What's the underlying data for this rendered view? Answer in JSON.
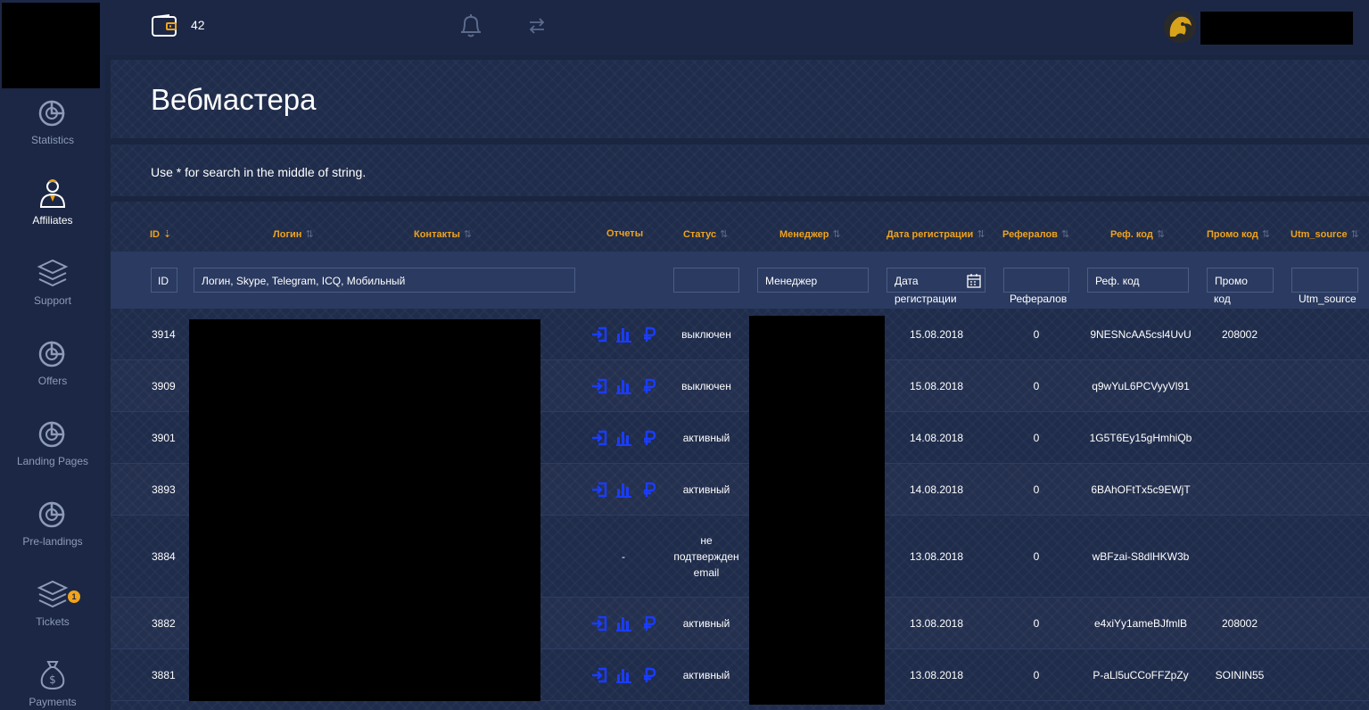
{
  "topbar": {
    "balance": "42"
  },
  "sidebar": {
    "items": [
      {
        "label": "Statistics",
        "icon": "pie-chart-icon"
      },
      {
        "label": "Affiliates",
        "icon": "user-icon",
        "active": true
      },
      {
        "label": "Support",
        "icon": "layers-icon"
      },
      {
        "label": "Offers",
        "icon": "pie-chart-icon"
      },
      {
        "label": "Landing Pages",
        "icon": "pie-chart-icon"
      },
      {
        "label": "Pre-landings",
        "icon": "pie-chart-icon"
      },
      {
        "label": "Tickets",
        "icon": "layers-icon",
        "badge": "1"
      },
      {
        "label": "Payments",
        "icon": "money-bag-icon"
      }
    ]
  },
  "page": {
    "title": "Вебмастера",
    "hint": "Use * for search in the middle of string."
  },
  "table": {
    "headers": {
      "id": "ID",
      "login": "Логин",
      "contacts": "Контакты",
      "reports": "Отчеты",
      "status": "Статус",
      "manager": "Менеджер",
      "reg_date": "Дата регистрации",
      "referrals": "Рефералов",
      "ref_code": "Реф. код",
      "promo_code": "Промо код",
      "utm_source": "Utm_source"
    },
    "filters": {
      "id": "ID",
      "login_contacts": "Логин, Skype, Telegram, ICQ, Мобильный",
      "status": "",
      "manager": "Менеджер",
      "reg_date_line1": "Дата",
      "reg_date_line2": "регистрации",
      "referrals": "Рефералов",
      "ref_code": "Реф. код",
      "promo_line1": "Промо",
      "promo_line2": "код",
      "utm_source": "Utm_source"
    },
    "rows": [
      {
        "id": "3914",
        "reports": true,
        "status": "выключен",
        "reg_date": "15.08.2018",
        "referrals": "0",
        "ref_code": "9NESNcAA5csl4UvU",
        "promo_code": "208002"
      },
      {
        "id": "3909",
        "reports": true,
        "status": "выключен",
        "reg_date": "15.08.2018",
        "referrals": "0",
        "ref_code": "q9wYuL6PCVyyVl91",
        "promo_code": ""
      },
      {
        "id": "3901",
        "reports": true,
        "status": "активный",
        "reg_date": "14.08.2018",
        "referrals": "0",
        "ref_code": "1G5T6Ey15gHmhiQb",
        "promo_code": ""
      },
      {
        "id": "3893",
        "reports": true,
        "status": "активный",
        "reg_date": "14.08.2018",
        "referrals": "0",
        "ref_code": "6BAhOFtTx5c9EWjT",
        "promo_code": ""
      },
      {
        "id": "3884",
        "reports": false,
        "reports_text": "-",
        "status_lines": [
          "не",
          "подтвержден",
          "email"
        ],
        "reg_date": "13.08.2018",
        "referrals": "0",
        "ref_code": "wBFzai-S8dlHKW3b",
        "promo_code": ""
      },
      {
        "id": "3882",
        "reports": true,
        "status": "активный",
        "reg_date": "13.08.2018",
        "referrals": "0",
        "ref_code": "e4xiYy1ameBJfmlB",
        "promo_code": "208002"
      },
      {
        "id": "3881",
        "reports": true,
        "status": "активный",
        "reg_date": "13.08.2018",
        "referrals": "0",
        "ref_code": "P-aLl5uCCoFFZpZy",
        "promo_code": "SOININ55"
      }
    ]
  },
  "colors": {
    "accent": "#f0a31b",
    "report_icon": "#1a3cff",
    "background": "#1f2c4b"
  }
}
